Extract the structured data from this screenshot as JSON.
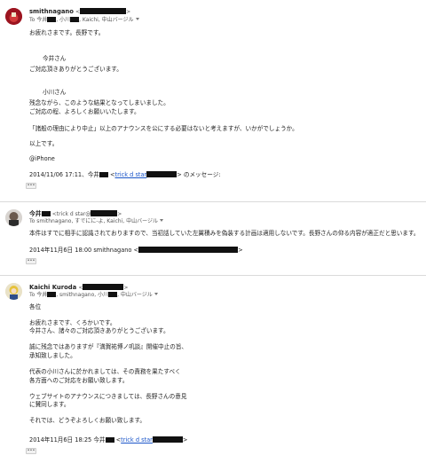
{
  "m1": {
    "sender": "smithnagano",
    "to_prefix": "To 今井",
    "to_rest": ", 小川",
    "to_rest2": ", Kaichi, 中山バージル",
    "body": [
      "お疲れさまです。長野です。",
      "今井さん",
      "ご対応頂きありがとうございます。",
      "小川さん",
      "残念ながら、このような結果となってしまいました。",
      "ご対応の程、よろしくお願いいたします。",
      "「諸般の理由により中止」以上のアナウンスを公にする必要はないと考えますが、いかがでしょうか。",
      "以上です。",
      "@iPhone"
    ],
    "quote_prefix": "2014/11/06 17:11、今井",
    "quote_link": "trick d star",
    "quote_suffix": "のメッセージ:"
  },
  "m2": {
    "sender": "今井",
    "addr": "<trick d star@",
    "to": "To smithnagano, すでにに-よ, Kaichi, 中山バージル",
    "body": "本件はすでに相手に認識されておりますので、当初話していた左翼積みを偽装する計画は適用しないです。長野さんの仰る内容が適正だと思います。",
    "quote_prefix": "2014年11月6日 18:00 smithnagano <"
  },
  "m3": {
    "sender": "Kaichi Kuroda",
    "to_prefix": "To 今井",
    "to_rest": ", smithnagano, 小川",
    "to_rest2": ", 中山バージル",
    "body": [
      "各位",
      "お疲れさまです、くろかいです。",
      "今井さん、諸々のご対応頂きありがとうございます。",
      "誠に残念ではありますが『満賀祐博ノ叽談』開催中止の旨、",
      "承知致しました。",
      "代表の小川さんに於かれましては、その責務を果たすべく",
      "各方面へのご対応をお願い致します。",
      "ウェブサイトのアナウンスにつきましては、長野さんの意見",
      "に賛同します。",
      "それでは、どうぞよろしくお願い致します。"
    ],
    "quote_prefix": "2014年11月6日 18:25 今井",
    "quote_link": "trick d star",
    "dots": "•••"
  }
}
